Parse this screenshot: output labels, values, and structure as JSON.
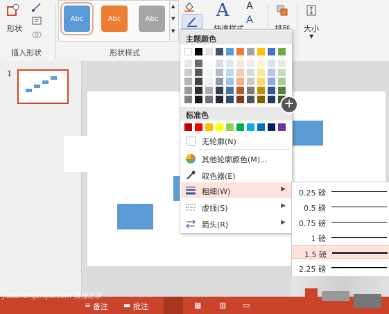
{
  "ribbon": {
    "insert_shapes": {
      "group_label": "插入形状",
      "shape_label": "形状"
    },
    "shape_styles": {
      "group_label": "形状样式",
      "tiles": [
        "Abc",
        "Abc",
        "Abc"
      ]
    },
    "wordart": {
      "label": "快速样式"
    },
    "arrange": {
      "label": "排列"
    },
    "size": {
      "label": "大小"
    }
  },
  "thumbs": {
    "slide_number": "1"
  },
  "menu": {
    "theme_header": "主题颜色",
    "standard_header": "标准色",
    "no_outline": "无轮廓(N)",
    "more_colors": "其他轮廓颜色(M)...",
    "eyedropper": "取色器(E)",
    "weight": "粗细(W)",
    "dashes": "虚线(S)",
    "arrows": "箭头(R)"
  },
  "theme_colors": [
    "#ffffff",
    "#000000",
    "#e7e6e6",
    "#44546a",
    "#5b9bd5",
    "#ed7d31",
    "#a5a5a5",
    "#ffc000",
    "#4472c4",
    "#70ad47"
  ],
  "standard_colors": [
    "#c00000",
    "#ff0000",
    "#ffc000",
    "#ffff00",
    "#92d050",
    "#00b050",
    "#00b0f0",
    "#0070c0",
    "#002060",
    "#7030a0"
  ],
  "weights": [
    {
      "label": "0.25 磅",
      "value": 0.25
    },
    {
      "label": "0.5 磅",
      "value": 0.5
    },
    {
      "label": "0.75 磅",
      "value": 0.75
    },
    {
      "label": "1 磅",
      "value": 1
    },
    {
      "label": "1.5 磅",
      "value": 1.5
    },
    {
      "label": "2.25 磅",
      "value": 2.25
    }
  ],
  "statusbar": {
    "notes": "备注",
    "comments": "批注"
  },
  "watermark": "jiaochengzhijia.com 教程之家"
}
